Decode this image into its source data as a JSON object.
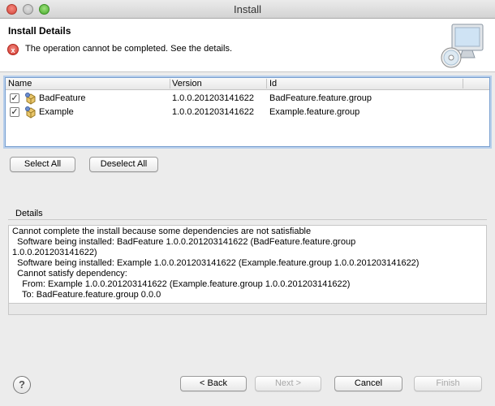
{
  "window": {
    "title": "Install"
  },
  "header": {
    "title": "Install Details",
    "message": "The operation cannot be completed.  See the details."
  },
  "table": {
    "columns": [
      "Name",
      "Version",
      "Id"
    ],
    "rows": [
      {
        "checked": true,
        "name": "BadFeature",
        "version": "1.0.0.201203141622",
        "id": "BadFeature.feature.group"
      },
      {
        "checked": true,
        "name": "Example",
        "version": "1.0.0.201203141622",
        "id": "Example.feature.group"
      }
    ]
  },
  "selection_buttons": {
    "select_all": "Select All",
    "deselect_all": "Deselect All"
  },
  "details": {
    "label": "Details",
    "lines": [
      "Cannot complete the install because some dependencies are not satisfiable",
      "  Software being installed: BadFeature 1.0.0.201203141622 (BadFeature.feature.group",
      "1.0.0.201203141622)",
      "  Software being installed: Example 1.0.0.201203141622 (Example.feature.group 1.0.0.201203141622)",
      "  Cannot satisfy dependency:",
      "    From: Example 1.0.0.201203141622 (Example.feature.group 1.0.0.201203141622)",
      "    To: BadFeature.feature.group 0.0.0"
    ]
  },
  "footer": {
    "help": "?",
    "back": "< Back",
    "next": "Next >",
    "cancel": "Cancel",
    "finish": "Finish"
  },
  "icons": {
    "error": "error-icon",
    "feature": "feature-icon",
    "install_banner": "install-banner-icon",
    "help": "help-icon"
  }
}
